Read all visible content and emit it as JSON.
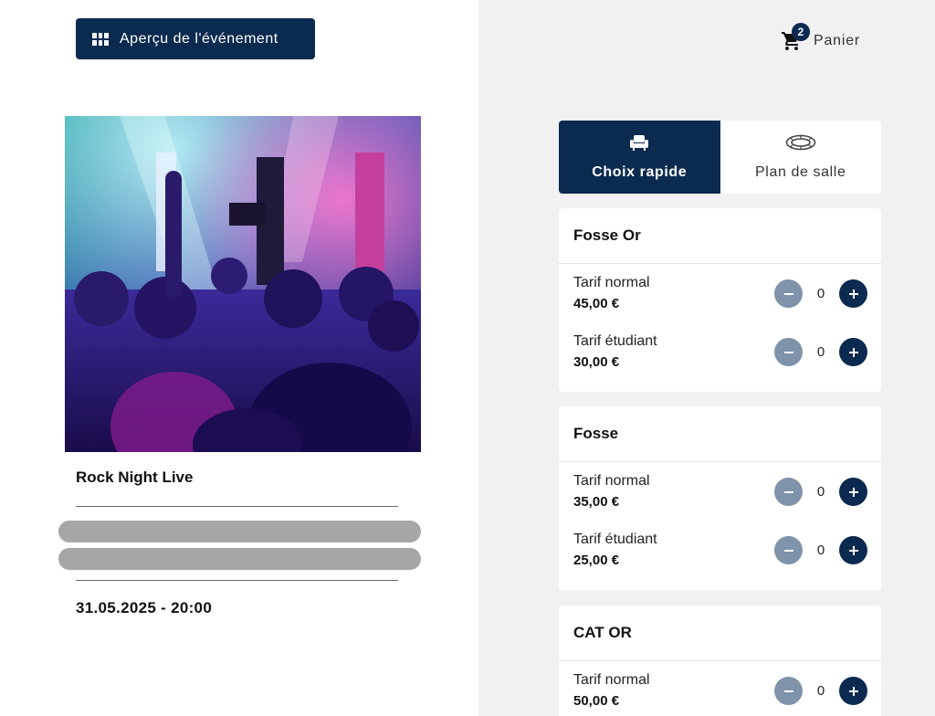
{
  "left": {
    "overview_button": "Aperçu de l'événement",
    "event_title": "Rock Night Live",
    "event_date": "31.05.2025 - 20:00"
  },
  "header": {
    "cart_label": "Panier",
    "cart_count": "2"
  },
  "tabs": [
    {
      "label": "Choix rapide",
      "icon": "armchair-icon",
      "active": true
    },
    {
      "label": "Plan de salle",
      "icon": "stadium-icon",
      "active": false
    }
  ],
  "categories": [
    {
      "name": "Fosse Or",
      "rates": [
        {
          "name": "Tarif normal",
          "price": "45,00 €",
          "qty": "0"
        },
        {
          "name": "Tarif étudiant",
          "price": "30,00 €",
          "qty": "0"
        }
      ]
    },
    {
      "name": "Fosse",
      "rates": [
        {
          "name": "Tarif normal",
          "price": "35,00 €",
          "qty": "0"
        },
        {
          "name": "Tarif étudiant",
          "price": "25,00 €",
          "qty": "0"
        }
      ]
    },
    {
      "name": "CAT OR",
      "rates": [
        {
          "name": "Tarif normal",
          "price": "50,00 €",
          "qty": "0"
        }
      ]
    }
  ],
  "colors": {
    "primary": "#0b2a4f",
    "minus_button": "#7f93aa",
    "panel_background": "#f1f1f1",
    "redaction": "#a6a6a6"
  }
}
